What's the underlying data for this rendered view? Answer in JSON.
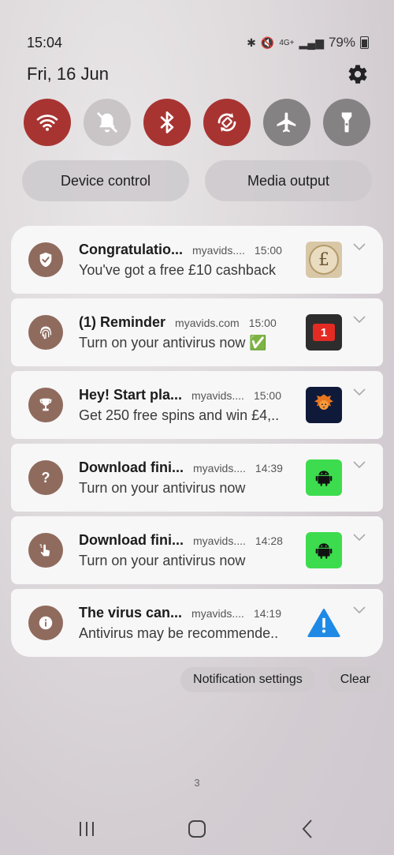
{
  "status": {
    "time": "15:04",
    "battery": "79%",
    "network": "4G+"
  },
  "header": {
    "date": "Fri, 16 Jun"
  },
  "quick_settings": [
    {
      "name": "wifi",
      "state": "on"
    },
    {
      "name": "mute",
      "state": "off"
    },
    {
      "name": "bluetooth",
      "state": "on"
    },
    {
      "name": "auto-rotate",
      "state": "on"
    },
    {
      "name": "airplane",
      "state": "off"
    },
    {
      "name": "flashlight",
      "state": "off"
    }
  ],
  "pills": {
    "device_control": "Device control",
    "media_output": "Media output"
  },
  "notifications": [
    {
      "title": "Congratulatio...",
      "app": "myavids....",
      "time": "15:00",
      "body": "You've got a free £10 cashback",
      "icon": "shield-check-icon",
      "thumb": "pound-coin"
    },
    {
      "title": "(1) Reminder",
      "app": "myavids.com",
      "time": "15:00",
      "body": "Turn on your antivirus now ✅",
      "icon": "fingerprint-icon",
      "thumb": "red-badge-1",
      "thumb_text": "1"
    },
    {
      "title": "Hey! Start pla...",
      "app": "myavids....",
      "time": "15:00",
      "body": "Get 250 free spins and win £4,..",
      "icon": "trophy-icon",
      "thumb": "lion-logo"
    },
    {
      "title": "Download fini...",
      "app": "myavids....",
      "time": "14:39",
      "body": "Turn on your antivirus now",
      "icon": "question-icon",
      "thumb": "android-green"
    },
    {
      "title": "Download fini...",
      "app": "myavids....",
      "time": "14:28",
      "body": "Turn on your antivirus now",
      "icon": "hand-tap-icon",
      "thumb": "android-green"
    },
    {
      "title": "The virus can...",
      "app": "myavids....",
      "time": "14:19",
      "body": "Antivirus may be recommende..",
      "icon": "info-icon",
      "thumb": "warning-triangle"
    }
  ],
  "actions": {
    "settings": "Notification settings",
    "clear": "Clear"
  },
  "page_indicator": "3",
  "colors": {
    "accent_on": "#a83432",
    "app_icon_bg": "#8f6b5e",
    "card_bg": "#f8f7f8",
    "android_green": "#3ddc4e"
  }
}
